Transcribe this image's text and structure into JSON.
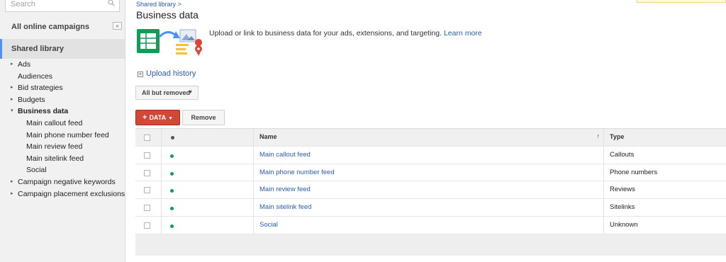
{
  "search": {
    "placeholder": "Search"
  },
  "sidebar": {
    "all_campaigns": "All online campaigns",
    "collapse_glyph": "«",
    "shared_library": "Shared library",
    "tree": [
      {
        "label": "Ads",
        "arrow": "▸",
        "bold": false,
        "child": false
      },
      {
        "label": "Audiences",
        "arrow": "",
        "bold": false,
        "child": false
      },
      {
        "label": "Bid strategies",
        "arrow": "▸",
        "bold": false,
        "child": false
      },
      {
        "label": "Budgets",
        "arrow": "▸",
        "bold": false,
        "child": false
      },
      {
        "label": "Business data",
        "arrow": "▾",
        "bold": true,
        "child": false
      },
      {
        "label": "Main callout feed",
        "arrow": "",
        "bold": false,
        "child": true
      },
      {
        "label": "Main phone number feed",
        "arrow": "",
        "bold": false,
        "child": true
      },
      {
        "label": "Main review feed",
        "arrow": "",
        "bold": false,
        "child": true
      },
      {
        "label": "Main sitelink feed",
        "arrow": "",
        "bold": false,
        "child": true
      },
      {
        "label": "Social",
        "arrow": "",
        "bold": false,
        "child": true
      },
      {
        "label": "Campaign negative keywords",
        "arrow": "▸",
        "bold": false,
        "child": false
      },
      {
        "label": "Campaign placement exclusions",
        "arrow": "▸",
        "bold": false,
        "child": false
      }
    ]
  },
  "main": {
    "breadcrumb": "Shared library >",
    "title": "Business data",
    "hero_text": "Upload or link to business data for your ads, extensions, and targeting.",
    "learn_more": "Learn more",
    "upload_history": "Upload history",
    "filter": "All but removed",
    "data_button": "DATA",
    "remove_button": "Remove",
    "columns": {
      "name": "Name",
      "type": "Type"
    },
    "rows": [
      {
        "name": "Main callout feed",
        "type": "Callouts"
      },
      {
        "name": "Main phone number feed",
        "type": "Phone numbers"
      },
      {
        "name": "Main review feed",
        "type": "Reviews"
      },
      {
        "name": "Main sitelink feed",
        "type": "Sitelinks"
      },
      {
        "name": "Social",
        "type": "Unknown"
      }
    ]
  },
  "colors": {
    "accent": "#d14836",
    "link": "#2a5db0",
    "status_enabled": "#0f9d58",
    "selected_bar": "#4d90fe"
  }
}
